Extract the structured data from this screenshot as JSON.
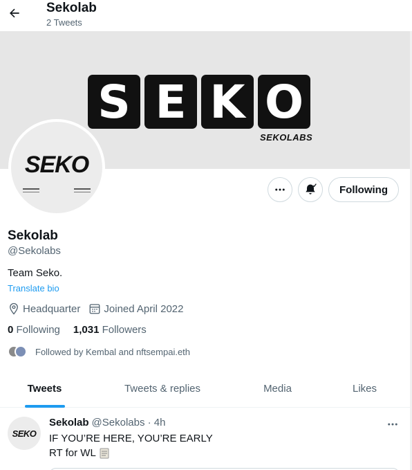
{
  "header": {
    "title": "Sekolab",
    "tweet_count": "2 Tweets"
  },
  "banner": {
    "letters": [
      "S",
      "E",
      "K",
      "O"
    ],
    "subtitle": "SEKOLABS"
  },
  "avatar": {
    "text": "SEKO"
  },
  "actions": {
    "follow_label": "Following"
  },
  "profile": {
    "name": "Sekolab",
    "handle": "@Sekolabs",
    "bio": "Team Seko.",
    "translate": "Translate bio",
    "location": "Headquarter",
    "joined": "Joined April 2022",
    "following_count": "0",
    "following_label": "Following",
    "followers_count": "1,031",
    "followers_label": "Followers",
    "followed_by": "Followed by Kembal and nftsempai.eth"
  },
  "tabs": [
    {
      "label": "Tweets",
      "active": true
    },
    {
      "label": "Tweets & replies",
      "active": false
    },
    {
      "label": "Media",
      "active": false
    },
    {
      "label": "Likes",
      "active": false
    }
  ],
  "tweet": {
    "avatar_text": "SEKO",
    "name": "Sekolab",
    "handle_time": "@Sekolabs · 4h",
    "line1": "IF YOU’RE HERE, YOU’RE EARLY",
    "line2": "RT for WL"
  },
  "colors": {
    "accent": "#1d9bf0",
    "muted": "#536471",
    "banner_bg": "#e6e6e6",
    "border": "#cfd9de"
  },
  "icons": [
    "back-arrow-icon",
    "more-dots-icon",
    "bell-icon",
    "location-pin-icon",
    "calendar-icon",
    "scroll-emoji-icon"
  ]
}
